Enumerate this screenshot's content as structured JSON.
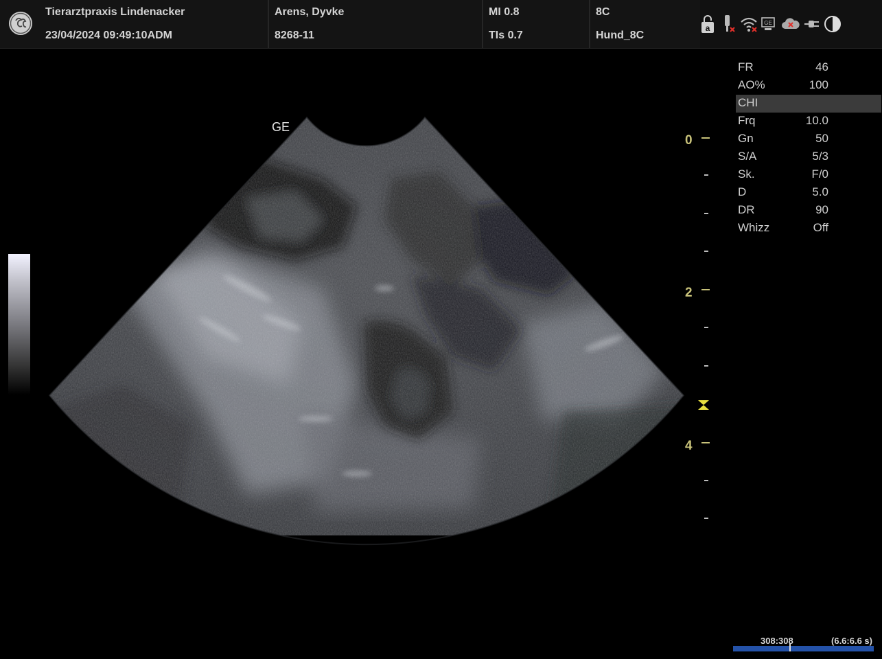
{
  "header": {
    "clinic": "Tierarztpraxis Lindenacker",
    "datetime": "23/04/2024 09:49:10ADM",
    "patient_name": "Arens, Dyvke",
    "patient_id": "8268-11",
    "mi": "MI 0.8",
    "tis": "TIs 0.7",
    "probe": "8C",
    "preset": "Hund_8C"
  },
  "status_icons": [
    "lock-icon",
    "probe-disconnected-icon",
    "wifi-disconnected-icon",
    "network-status-icon",
    "cloud-disconnected-icon",
    "power-plug-icon",
    "contrast-icon"
  ],
  "status_icon_letter": "a",
  "scan": {
    "vendor_mark": "GE"
  },
  "depth_scale": {
    "labels": [
      "0",
      "2",
      "4"
    ],
    "focus_marker": "focus-marker"
  },
  "params": [
    {
      "key": "FR",
      "value": "46"
    },
    {
      "key": "AO%",
      "value": "100"
    },
    {
      "key": "CHI",
      "value": "",
      "section": true
    },
    {
      "key": "Frq",
      "value": "10.0"
    },
    {
      "key": "Gn",
      "value": "50"
    },
    {
      "key": "S/A",
      "value": "5/3"
    },
    {
      "key": "Sk.",
      "value": "F/0"
    },
    {
      "key": "D",
      "value": "5.0"
    },
    {
      "key": "DR",
      "value": "90"
    },
    {
      "key": "Whizz",
      "value": "Off"
    }
  ],
  "cine": {
    "frames": "308:308",
    "time": "(6.6:6.6 s)",
    "position_fraction": 0.4
  },
  "colors": {
    "depth_accent": "#c8c27a",
    "cine_track": "#2452a8",
    "focus_marker": "#e8e040"
  }
}
